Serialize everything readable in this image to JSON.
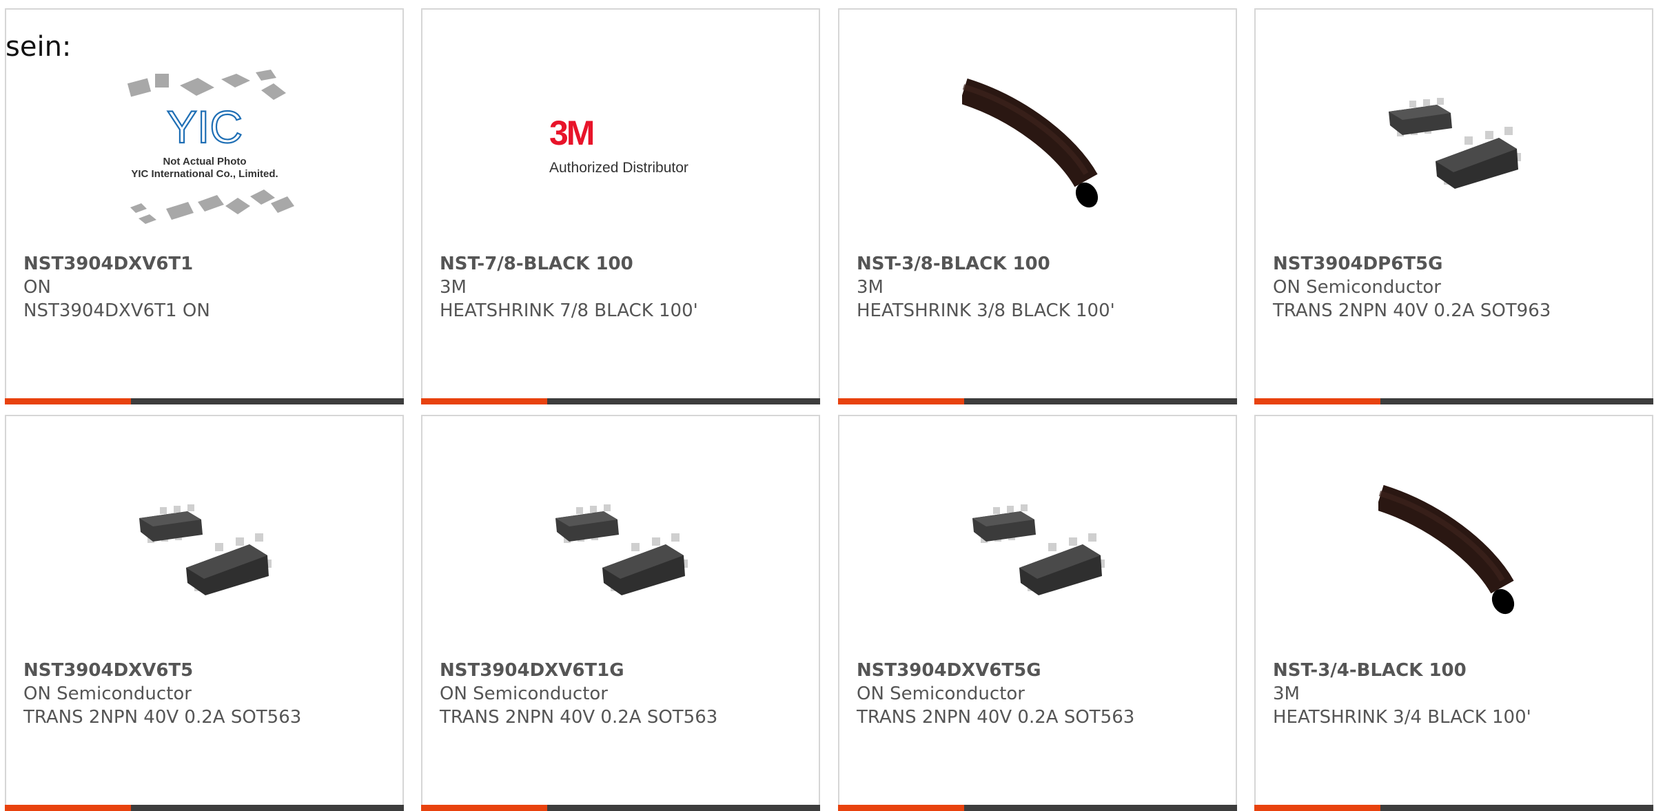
{
  "page": {
    "lead_text": "sein:"
  },
  "colors": {
    "accent_bar": "#e8420e",
    "dark_bar": "#3d3d3d",
    "card_border": "#d6d6d6",
    "text": "#555555",
    "brand_3m": "#e8142a",
    "yic_logo": "#1f6fb5"
  },
  "logos": {
    "yic_placeholder": {
      "logo_text": "YIC",
      "caption_line1": "Not Actual Photo",
      "caption_line2": "YIC International Co., Limited."
    },
    "threem_distributor": {
      "logo_text": "3M",
      "caption": "Authorized Distributor"
    }
  },
  "products": [
    {
      "part_number": "NST3904DXV6T1",
      "manufacturer": "ON",
      "description": "NST3904DXV6T1 ON",
      "image": "yic-placeholder-image"
    },
    {
      "part_number": "NST-7/8-BLACK 100",
      "manufacturer": "3M",
      "description": "HEATSHRINK 7/8 BLACK 100'",
      "image": "3m-authorized-distributor-logo"
    },
    {
      "part_number": "NST-3/8-BLACK 100",
      "manufacturer": "3M",
      "description": "HEATSHRINK 3/8 BLACK 100'",
      "image": "black-heatshrink-tube-image"
    },
    {
      "part_number": "NST3904DP6T5G",
      "manufacturer": "ON Semiconductor",
      "description": "TRANS 2NPN 40V 0.2A SOT963",
      "image": "sot-chip-pair-image"
    },
    {
      "part_number": "NST3904DXV6T5",
      "manufacturer": "ON Semiconductor",
      "description": "TRANS 2NPN 40V 0.2A SOT563",
      "image": "sot-chip-pair-image"
    },
    {
      "part_number": "NST3904DXV6T1G",
      "manufacturer": "ON Semiconductor",
      "description": "TRANS 2NPN 40V 0.2A SOT563",
      "image": "sot-chip-pair-image"
    },
    {
      "part_number": "NST3904DXV6T5G",
      "manufacturer": "ON Semiconductor",
      "description": "TRANS 2NPN 40V 0.2A SOT563",
      "image": "sot-chip-pair-image"
    },
    {
      "part_number": "NST-3/4-BLACK 100",
      "manufacturer": "3M",
      "description": "HEATSHRINK 3/4 BLACK 100'",
      "image": "black-heatshrink-tube-image"
    }
  ]
}
